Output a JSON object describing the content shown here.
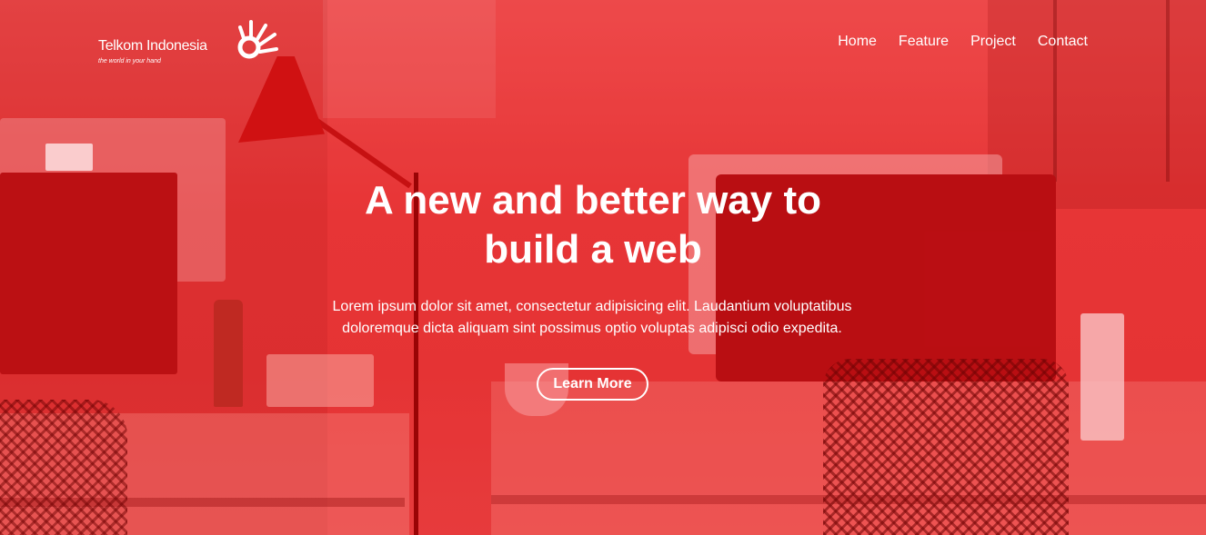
{
  "brand": {
    "name": "Telkom Indonesia",
    "tagline": "the world in your hand",
    "logo_icon": "telkom-hand-icon",
    "logo_color": "#ffffff"
  },
  "nav": {
    "items": [
      {
        "label": "Home"
      },
      {
        "label": "Feature"
      },
      {
        "label": "Project"
      },
      {
        "label": "Contact"
      }
    ]
  },
  "hero": {
    "title": "A new and better way to build a web",
    "text": "Lorem ipsum dolor sit amet, consectetur adipisicing elit. Laudantium voluptatibus doloremque dicta aliquam sint possimus optio voluptas adipisci odio expedita.",
    "button_label": "Learn More",
    "overlay_color": "#e53935",
    "background_image": "office-desks-photo"
  }
}
